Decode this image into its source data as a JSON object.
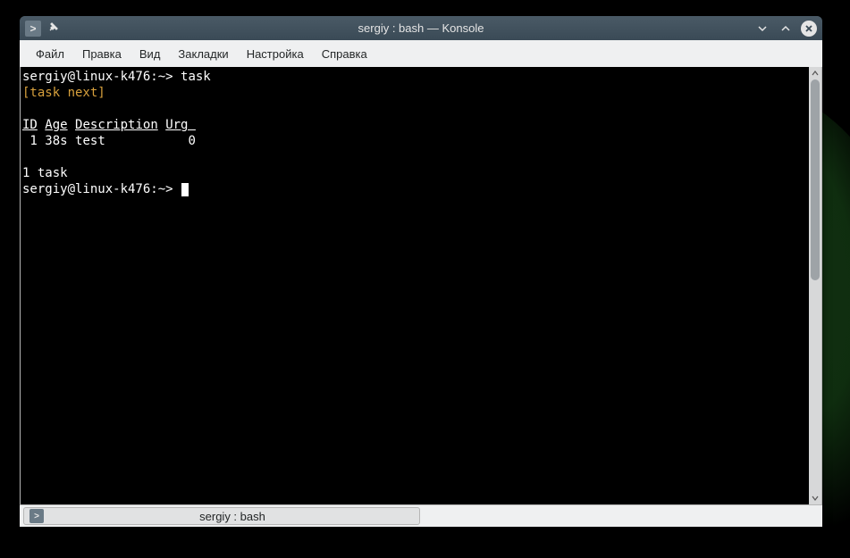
{
  "window": {
    "title": "sergiy : bash — Konsole"
  },
  "menubar": {
    "items": [
      "Файл",
      "Правка",
      "Вид",
      "Закладки",
      "Настройка",
      "Справка"
    ]
  },
  "terminal": {
    "prompt1": "sergiy@linux-k476:~> ",
    "command1": "task",
    "task_next": "[task next]",
    "headers": {
      "id": "ID",
      "age": "Age",
      "description": "Description",
      "urg": "Urg "
    },
    "rows": [
      {
        "id": " 1",
        "age": "38s",
        "description": "test",
        "urg": "0"
      }
    ],
    "summary": "1 task",
    "prompt2": "sergiy@linux-k476:~> "
  },
  "tab": {
    "label": "sergiy : bash"
  }
}
